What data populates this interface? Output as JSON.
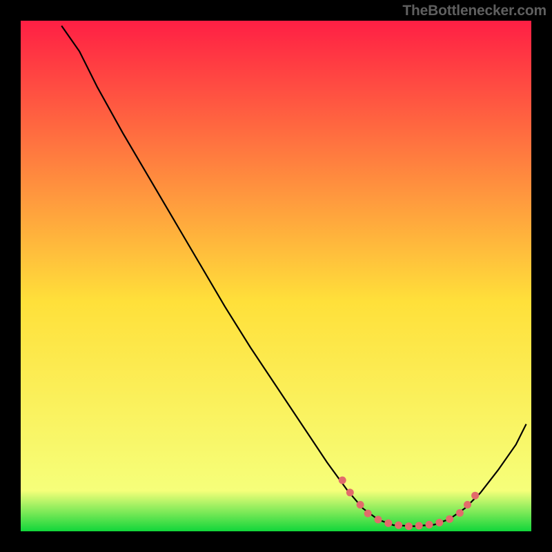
{
  "watermark": "TheBottlenecker.com",
  "chart_data": {
    "type": "line",
    "title": "",
    "xlabel": "",
    "ylabel": "",
    "xlim": [
      0,
      100
    ],
    "ylim": [
      0,
      100
    ],
    "gradient": {
      "top": "#ff1f44",
      "mid": "#ffe03a",
      "bottom": "#11d63a"
    },
    "curve": [
      {
        "x": 8.0,
        "y": 99.0
      },
      {
        "x": 11.5,
        "y": 94.0
      },
      {
        "x": 15.0,
        "y": 87.0
      },
      {
        "x": 20.0,
        "y": 78.0
      },
      {
        "x": 25.0,
        "y": 69.5
      },
      {
        "x": 30.0,
        "y": 61.0
      },
      {
        "x": 35.0,
        "y": 52.5
      },
      {
        "x": 40.0,
        "y": 44.0
      },
      {
        "x": 45.0,
        "y": 36.0
      },
      {
        "x": 50.0,
        "y": 28.5
      },
      {
        "x": 55.0,
        "y": 21.0
      },
      {
        "x": 60.0,
        "y": 13.5
      },
      {
        "x": 64.0,
        "y": 8.0
      },
      {
        "x": 67.0,
        "y": 4.5
      },
      {
        "x": 70.0,
        "y": 2.3
      },
      {
        "x": 73.0,
        "y": 1.2
      },
      {
        "x": 77.0,
        "y": 1.0
      },
      {
        "x": 81.0,
        "y": 1.3
      },
      {
        "x": 84.0,
        "y": 2.4
      },
      {
        "x": 87.0,
        "y": 4.5
      },
      {
        "x": 90.0,
        "y": 7.5
      },
      {
        "x": 93.5,
        "y": 12.0
      },
      {
        "x": 97.0,
        "y": 17.0
      },
      {
        "x": 99.0,
        "y": 21.0
      }
    ],
    "markers": [
      {
        "x": 63.0,
        "y": 10.0
      },
      {
        "x": 64.5,
        "y": 7.6
      },
      {
        "x": 66.5,
        "y": 5.2
      },
      {
        "x": 68.0,
        "y": 3.5
      },
      {
        "x": 70.0,
        "y": 2.3
      },
      {
        "x": 72.0,
        "y": 1.6
      },
      {
        "x": 74.0,
        "y": 1.2
      },
      {
        "x": 76.0,
        "y": 1.0
      },
      {
        "x": 78.0,
        "y": 1.1
      },
      {
        "x": 80.0,
        "y": 1.3
      },
      {
        "x": 82.0,
        "y": 1.7
      },
      {
        "x": 84.0,
        "y": 2.4
      },
      {
        "x": 86.0,
        "y": 3.6
      },
      {
        "x": 87.5,
        "y": 5.2
      },
      {
        "x": 89.0,
        "y": 7.0
      }
    ],
    "curve_color": "#000000",
    "marker_color": "#e26b6b"
  }
}
